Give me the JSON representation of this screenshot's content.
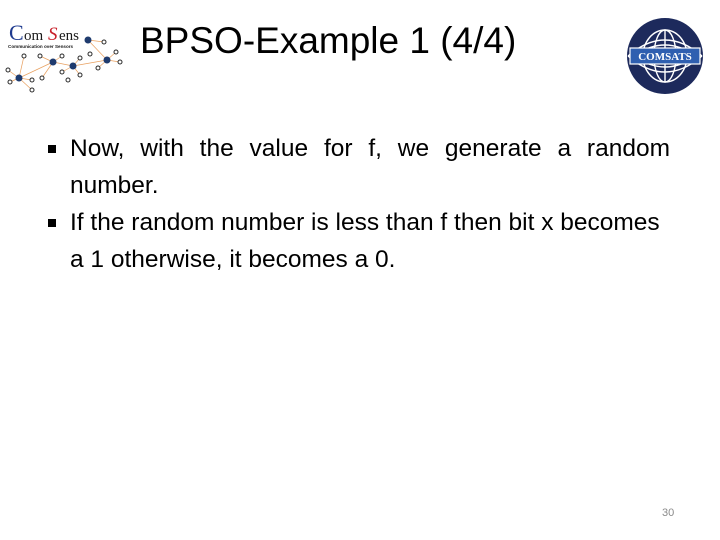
{
  "slide": {
    "title": "BPSO-Example 1 (4/4)",
    "logos": {
      "left": {
        "name": "ComSens",
        "tagline": "Communication over Sensors",
        "colors": {
          "C": "#1f3b8f",
          "S": "#c8202a",
          "text": "#1a1a1a",
          "nodes": "#1f3b6e"
        }
      },
      "right": {
        "name": "COMSATS",
        "colors": {
          "circle": "#1d2a5c",
          "band": "#2f5fb0",
          "text": "#ffffff"
        }
      }
    },
    "bullets": [
      {
        "text": "Now, with the value for f, we generate a random number."
      },
      {
        "text": "If the random number is less than f then bit x becomes a 1 otherwise, it becomes a 0."
      }
    ],
    "page_number": "30"
  }
}
